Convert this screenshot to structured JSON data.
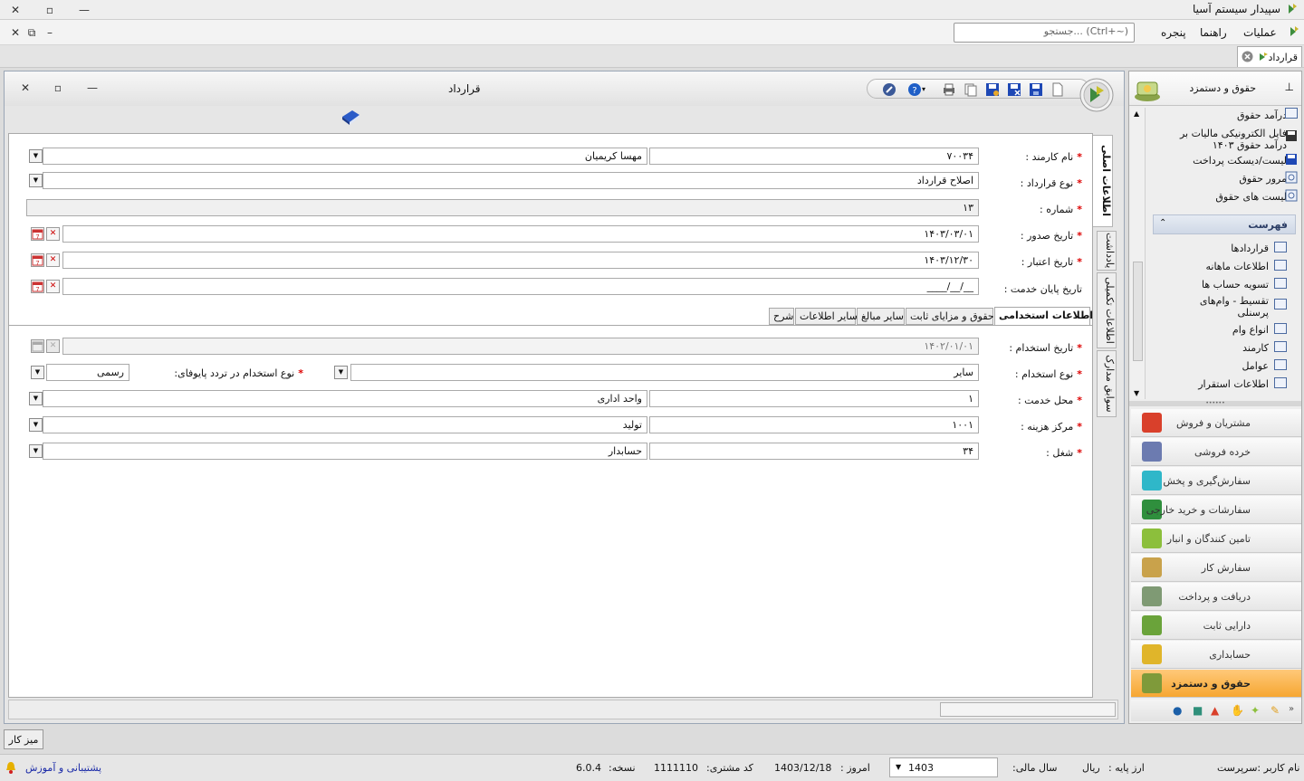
{
  "app": {
    "title": "سپیدار سیستم آسیا"
  },
  "menu": {
    "items": [
      "عملیات",
      "راهنما",
      "پنجره"
    ],
    "search_placeholder": "جستجو... (Ctrl+~)"
  },
  "doc_tab": {
    "label": "قرارداد"
  },
  "form": {
    "title": "قرارداد",
    "vertical_tabs": [
      "اطلاعات اصلی",
      "یادداشت",
      "اطلاعات تکمیلی",
      "سوابق مدارک"
    ],
    "fields": {
      "employee_name": {
        "label": "نام کارمند :",
        "code": "۷۰۰۳۴",
        "name": "مهسا کریمیان"
      },
      "contract_type": {
        "label": "نوع قرارداد :",
        "value": "اصلاح قرارداد"
      },
      "number": {
        "label": "شماره :",
        "value": "۱۳"
      },
      "issue_date": {
        "label": "تاریخ صدور :",
        "value": "۱۴۰۳/۰۳/۰۱"
      },
      "valid_date": {
        "label": "تاریخ اعتبار :",
        "value": "۱۴۰۳/۱۲/۳۰"
      },
      "end_date": {
        "label": "تاریخ پایان خدمت :",
        "value": "__/__/____"
      }
    },
    "inner_tabs": [
      "اطلاعات استخدامی",
      "حقوق و مزایای ثابت",
      "سایر مبالغ",
      "سایر اطلاعات",
      "شرح"
    ],
    "employment": {
      "hire_date": {
        "label": "تاریخ استخدام :",
        "value": "۱۴۰۲/۰۱/۰۱"
      },
      "employment_type": {
        "label": "نوع استخدام :",
        "value": "سایر"
      },
      "pass_type": {
        "label": "نوع استخدام در تردد پایوفای:",
        "value": "رسمی"
      },
      "service_place": {
        "label": "محل خدمت :",
        "code": "۱",
        "name": "واحد اداری"
      },
      "cost_center": {
        "label": "مرکز هزینه :",
        "code": "۱۰۰۱",
        "name": "تولید"
      },
      "job": {
        "label": "شغل :",
        "code": "۳۴",
        "name": "حسابدار"
      }
    }
  },
  "right_panel": {
    "title": "حقوق و دستمزد",
    "top_items": [
      "درآمد حقوق",
      "فایل الکترونیکی مالیات بر درآمد حقوق ۱۴۰۳",
      "لیست/دیسکت پرداخت",
      "مرور حقوق",
      "لیست های حقوق"
    ],
    "section_title": "فهرست",
    "list_items": [
      "قراردادها",
      "اطلاعات ماهانه",
      "تسویه حساب ها",
      "تقسیط - وام‌های پرسنلی",
      "انواع وام",
      "کارمند",
      "عوامل",
      "اطلاعات استقرار"
    ],
    "modules": [
      {
        "label": "مشتریان و فروش",
        "color": "#d9402b"
      },
      {
        "label": "خرده فروشی",
        "color": "#6c7bb0"
      },
      {
        "label": "سفارش‌گیری و پخش",
        "color": "#2fb7c9"
      },
      {
        "label": "سفارشات و خرید خارجی",
        "color": "#2f8f3d"
      },
      {
        "label": "تامین کنندگان و انبار",
        "color": "#8cbf3c"
      },
      {
        "label": "سفارش کار",
        "color": "#c9a24b"
      },
      {
        "label": "دریافت و پرداخت",
        "color": "#7f9a74"
      },
      {
        "label": "دارایی ثابت",
        "color": "#6aa33a"
      },
      {
        "label": "حسابداری",
        "color": "#e0b52a"
      },
      {
        "label": "حقوق و دستمزد",
        "color": "#7f9a3a"
      }
    ],
    "active_module": "حقوق و دستمزد"
  },
  "desk": {
    "label": "میز کار"
  },
  "status": {
    "user": "نام کاربر :سرپرست",
    "base_currency_label": "ارز پایه :",
    "base_currency": "ریال",
    "fiscal_year_label": "سال مالی:",
    "fiscal_year": "1403",
    "today_label": "امروز :",
    "today": "1403/12/18",
    "customer_label": "کد مشتری:",
    "customer_code": "1111110",
    "version_label": "نسخه:",
    "version": "6.0.4",
    "support": "پشتیبانی و آموزش"
  },
  "colors": {
    "accent": "#f6a631",
    "link": "#1a2aa8"
  }
}
